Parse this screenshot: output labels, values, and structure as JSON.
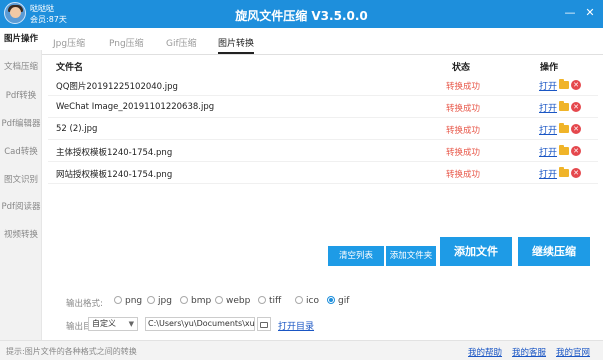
{
  "titlebar": {
    "user_name": "哒哒哒",
    "member_text": "会员:87天",
    "title": "旋风文件压缩 V3.5.0.0",
    "minimize_glyph": "—",
    "close_glyph": "✕"
  },
  "sidebar": {
    "items": [
      {
        "label": "图片操作",
        "active": true
      },
      {
        "label": "文档压缩"
      },
      {
        "label": "Pdf转换"
      },
      {
        "label": "Pdf编辑器"
      },
      {
        "label": "Cad转换"
      },
      {
        "label": "图文识别"
      },
      {
        "label": "Pdf阅读器"
      },
      {
        "label": "视频转换"
      }
    ]
  },
  "tabs": [
    {
      "label": "Jpg压缩"
    },
    {
      "label": "Png压缩"
    },
    {
      "label": "Gif压缩"
    },
    {
      "label": "图片转换",
      "active": true
    }
  ],
  "table": {
    "headers": {
      "filename": "文件名",
      "status": "状态",
      "action": "操作"
    },
    "rows": [
      {
        "filename": "QQ图片20191225102040.jpg",
        "status": "转换成功",
        "open": "打开"
      },
      {
        "filename": "WeChat Image_20191101220638.jpg",
        "status": "转换成功",
        "open": "打开"
      },
      {
        "filename": "52 (2).jpg",
        "status": "转换成功",
        "open": "打开"
      },
      {
        "filename": "主体授权模板1240-1754.png",
        "status": "转换成功",
        "open": "打开"
      },
      {
        "filename": "网站授权模板1240-1754.png",
        "status": "转换成功",
        "open": "打开"
      }
    ]
  },
  "buttons": {
    "clear_list": "清空列表",
    "add_folder": "添加文件夹",
    "add_file": "添加文件",
    "continue_compress": "继续压缩"
  },
  "output_format": {
    "label": "输出格式:",
    "options": [
      "png",
      "jpg",
      "bmp",
      "webp",
      "tiff",
      "ico",
      "gif"
    ],
    "selected": "gif"
  },
  "output_dir": {
    "label": "输出目录:",
    "mode": "自定义",
    "path": "C:\\Users\\yu\\Documents\\xuanfe",
    "open_dir": "打开目录"
  },
  "statusbar": {
    "hint": "提示:图片文件的各种格式之间的转换",
    "help": "我的帮助",
    "service": "我的客服",
    "website": "我的官网"
  },
  "colors": {
    "accent": "#1e8fdc",
    "status_success": "#e8584a",
    "link": "#1a56c4"
  }
}
